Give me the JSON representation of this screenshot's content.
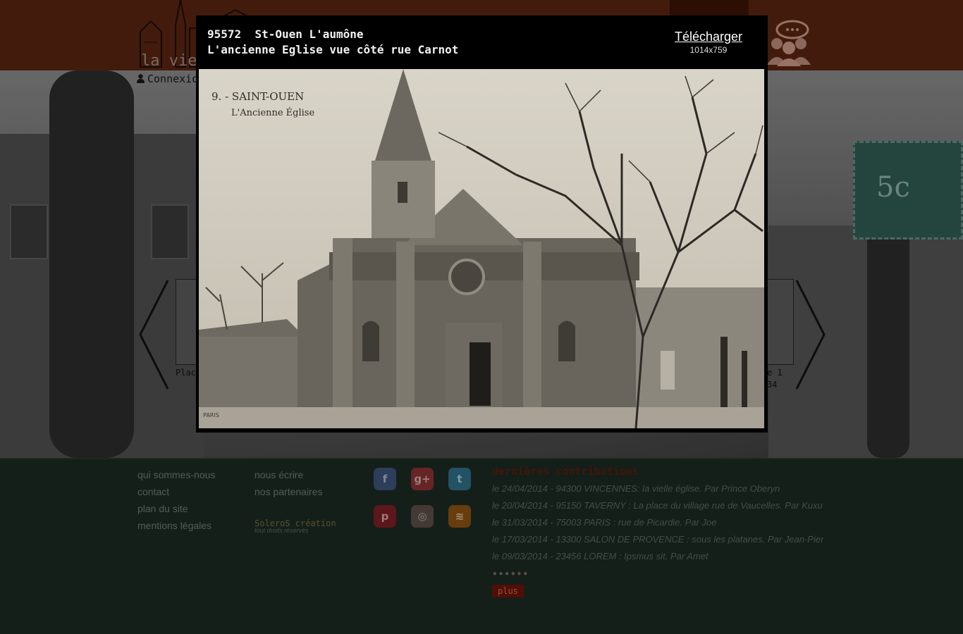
{
  "header": {
    "logo_text": "la viei",
    "login_label": "Connexio"
  },
  "carousel": {
    "left_caption": "Place",
    "right_caption_line1": "e 1",
    "right_caption_line2": "34"
  },
  "lightbox": {
    "id": "95572",
    "location": "St-Ouen L'aumône",
    "title": "L'ancienne Eglise vue côté rue Carnot",
    "download_label": "Télécharger",
    "image_size": "1014x759",
    "postcard_caption_line1": "9. - SAINT-OUEN",
    "postcard_caption_line2": "L'Ancienne Église",
    "postcard_mark": "PARIS"
  },
  "stamp": {
    "value": "5c"
  },
  "footer": {
    "links_col1": [
      "qui sommes-nous",
      "contact",
      "plan du site",
      "mentions légales"
    ],
    "links_col2": [
      "nous écrire",
      "nos partenaires"
    ],
    "credit_name": "SoleroS création",
    "credit_sub": "tout droits réservés",
    "social": [
      {
        "name": "facebook",
        "glyph": "f"
      },
      {
        "name": "google-plus",
        "glyph": "g+"
      },
      {
        "name": "twitter",
        "glyph": "t"
      },
      {
        "name": "pinterest",
        "glyph": "p"
      },
      {
        "name": "instagram",
        "glyph": "◎"
      },
      {
        "name": "rss",
        "glyph": "≋"
      }
    ],
    "contributions_title": "dernières contributions",
    "contributions": [
      "le 24/04/2014 - 94300 VINCENNES: la vielle église.  Par Prince Oberyn",
      "le 20/04/2014 - 95150 TAVERNY : La place du village rue de Vaucelles.  Par Kuxu",
      "le 31/03/2014 - 75003 PARIS : rue de Picardie.  Par Joe",
      "le 17/03/2014 - 13300 SALON DE PROVENCE : sous les platanes.  Par Jean-Pierre",
      "le 09/03/2014 - 23456 LOREM : Ipsmus sit. Par Amet"
    ],
    "dots": "••••••",
    "more_label": "plus"
  }
}
